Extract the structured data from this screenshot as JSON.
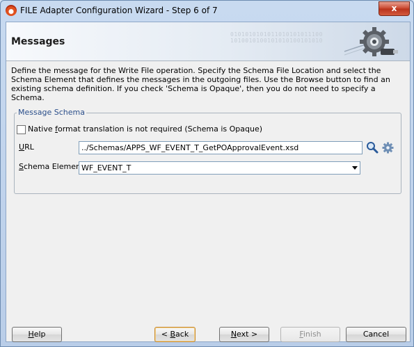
{
  "window": {
    "title": "FILE Adapter Configuration Wizard - Step 6 of 7",
    "close_label": "x"
  },
  "header": {
    "title": "Messages",
    "binary_lines": [
      "0101010101011010101011100",
      "1010010100101010100101010"
    ]
  },
  "description": "Define the message for the Write File operation.  Specify the Schema File Location and select the Schema Element that defines the messages in the outgoing files. Use the Browse button to find an existing schema definition. If you check 'Schema is Opaque', then you do not need to specify a Schema.",
  "message_schema": {
    "legend": "Message Schema",
    "opaque_checkbox": {
      "checked": false,
      "label_pre": "Native ",
      "label_mnemonic": "f",
      "label_post": "ormat translation is not required (Schema is Opaque)"
    },
    "url": {
      "label_mnemonic": "U",
      "label_post": "RL",
      "value": "../Schemas/APPS_WF_EVENT_T_GetPOApprovalEvent.xsd"
    },
    "schema_element": {
      "label_mnemonic": "S",
      "label_post": "chema Element",
      "value": "WF_EVENT_T"
    }
  },
  "footer": {
    "help": {
      "mnemonic": "H",
      "post": "elp"
    },
    "back": {
      "pre": "< ",
      "mnemonic": "B",
      "post": "ack"
    },
    "next": {
      "mnemonic": "N",
      "post": "ext >"
    },
    "finish": {
      "mnemonic": "F",
      "post": "inish"
    },
    "cancel": {
      "label": "Cancel"
    }
  },
  "icons": {
    "app": "adapter-app-icon",
    "search": "search-icon",
    "settings": "gear-icon",
    "banner": "gear-graphic"
  }
}
